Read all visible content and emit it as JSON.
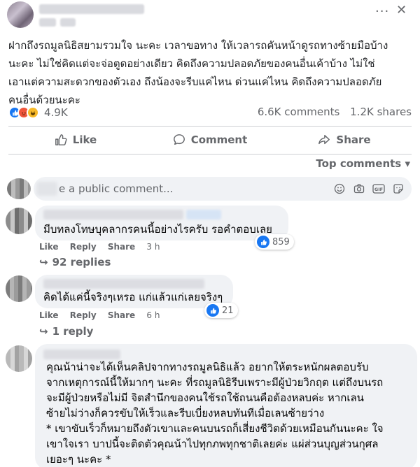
{
  "post": {
    "more_icon": "more-dots-icon",
    "close_icon": "close-icon",
    "text_lines": [
      "ฝากถึงรถมูลนิธิสยามรวมใจ  นะคะ  เวลาขอทาง  ให้เวลารถคันหน้าดูรถทางซ้ายมือบ้าง",
      "นะคะ  ไม่ใช่คิดแต่จะจ่อตูดอย่างเดียว  คิดถึงความปลอดภัยของคนอื่นเค้าบ้าง  ไม่ใช่",
      "เอาแต่ความสะดวกของตัวเอง  ถึงน้องจะรีบแค่ไหน  ด่วนแค่ไหน  คิดถึงความปลอดภัย",
      "คนอื่นด้วยนะคะ"
    ],
    "reaction_count": "4.9K",
    "comments_count": "6.6K comments",
    "shares_count": "1.2K shares",
    "reaction_icons": [
      "like-reaction-icon",
      "angry-reaction-icon",
      "haha-reaction-icon"
    ]
  },
  "actions": {
    "like": "Like",
    "comment": "Comment",
    "share": "Share"
  },
  "sort": {
    "label": "Top comments ▾"
  },
  "composer": {
    "placeholder": "e a public comment...",
    "icons": [
      "emoji-icon",
      "camera-icon",
      "gif-icon",
      "sticker-icon"
    ]
  },
  "comments": [
    {
      "text": "มีบทลงโทษบุคลากรคนนี้อย่างไรครับ รอคำตอบเลย",
      "like": "Like",
      "reply": "Reply",
      "share": "Share",
      "time": "3 h",
      "reactions": "859",
      "replies": "92 replies"
    },
    {
      "text": "คิดได้แค่นี้จริงๆเหรอ แก่แล้วแก่เลยจริงๆ",
      "like": "Like",
      "reply": "Reply",
      "share": "Share",
      "time": "6 h",
      "reactions": "21",
      "replies": "1 reply"
    },
    {
      "lines": [
        "คุณน้าน่าจะได้เห็นคลิปจากทางรถมูลนิธิแล้ว  อยากให้ตระหนักผลตอบรับ",
        "จากเหตุการณ์นี้ให้มากๆ นะคะ  ที่รถมูลนิธิรีบเพราะมีผู้ป่วยวิกฤต  แต่ถึงบนรถ",
        "จะมีผู้ป่วยหรือไม่มี  จิตสำนึกของคนใช้รถใช้ถนนคือต้องหลบค่ะ  หากเลน",
        "ซ้ายไม่ว่างก็ควรขับให้เร็วและรีบเบี่ยงหลบทันทีเมื่อเลนซ้ายว่าง",
        "*  เขาขับเร็วก็หมายถึงตัวเขาและคนบนรถก็เสี่ยงชีวิตด้วยเหมือนกันนะคะ  ใจ",
        "เขาใจเรา  บาปนี้จะติดตัวคุณน้าไปทุกภพทุกชาติเลยค่ะ  แผ่ส่วนบุญส่วนกุศล",
        "เยอะๆ นะคะ  *"
      ]
    }
  ]
}
